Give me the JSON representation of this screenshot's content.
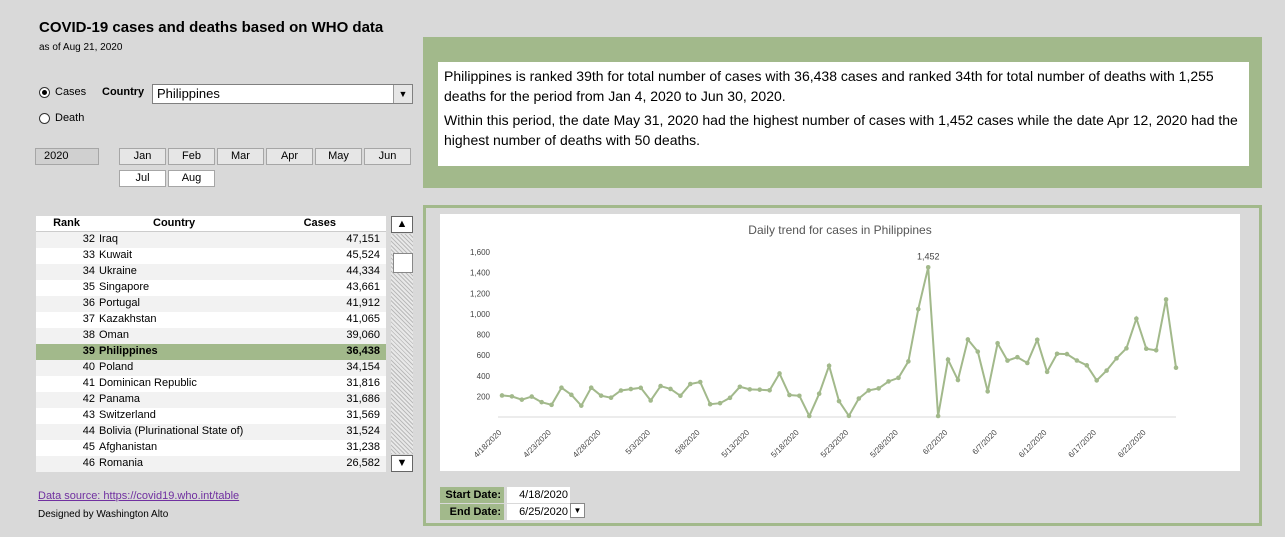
{
  "header": {
    "title": "COVID-19 cases and deaths based on WHO data",
    "asof": "as of Aug 21, 2020"
  },
  "metric": {
    "options": [
      "Cases",
      "Death"
    ],
    "selected": "Cases"
  },
  "country": {
    "label": "Country",
    "value": "Philippines"
  },
  "year_slicer": {
    "items": [
      "2020"
    ]
  },
  "month_slicer": {
    "items": [
      "Jan",
      "Feb",
      "Mar",
      "Apr",
      "May",
      "Jun",
      "Jul",
      "Aug"
    ]
  },
  "table": {
    "headers": [
      "Rank",
      "Country",
      "Cases"
    ],
    "rows": [
      {
        "rank": "32",
        "country": "Iraq",
        "cases": "47,151"
      },
      {
        "rank": "33",
        "country": "Kuwait",
        "cases": "45,524"
      },
      {
        "rank": "34",
        "country": "Ukraine",
        "cases": "44,334"
      },
      {
        "rank": "35",
        "country": "Singapore",
        "cases": "43,661"
      },
      {
        "rank": "36",
        "country": "Portugal",
        "cases": "41,912"
      },
      {
        "rank": "37",
        "country": "Kazakhstan",
        "cases": "41,065"
      },
      {
        "rank": "38",
        "country": "Oman",
        "cases": "39,060"
      },
      {
        "rank": "39",
        "country": "Philippines",
        "cases": "36,438",
        "highlight": true
      },
      {
        "rank": "40",
        "country": "Poland",
        "cases": "34,154"
      },
      {
        "rank": "41",
        "country": "Dominican Republic",
        "cases": "31,816"
      },
      {
        "rank": "42",
        "country": "Panama",
        "cases": "31,686"
      },
      {
        "rank": "43",
        "country": "Switzerland",
        "cases": "31,569"
      },
      {
        "rank": "44",
        "country": "Bolivia (Plurinational State of)",
        "cases": "31,524"
      },
      {
        "rank": "45",
        "country": "Afghanistan",
        "cases": "31,238"
      },
      {
        "rank": "46",
        "country": "Romania",
        "cases": "26,582"
      }
    ]
  },
  "scroll": {
    "up": "▲",
    "down": "▼"
  },
  "footer": {
    "source": "Data source: https://covid19.who.int/table",
    "designer": "Designed by Washington Alto"
  },
  "summary": {
    "line1": "Philippines is ranked 39th for total number of cases with 36,438 cases  and ranked 34th for total number of deaths with 1,255 deaths for the period from Jan 4, 2020 to Jun 30, 2020.",
    "line2": "Within this period, the date May 31, 2020 had the highest number of cases with 1,452 cases while the date Apr 12, 2020 had the highest number of deaths with 50 deaths."
  },
  "dates": {
    "start_label": "Start Date:",
    "start_value": "4/18/2020",
    "end_label": "End Date:",
    "end_value": "6/25/2020"
  },
  "colors": {
    "accent": "#a2b98b",
    "line": "#a2b98b"
  },
  "chart_data": {
    "type": "line",
    "title": "Daily trend for cases in Philippines",
    "xlabel": "",
    "ylabel": "",
    "ylim": [
      0,
      1600
    ],
    "yticks": [
      "200",
      "400",
      "600",
      "800",
      "1,000",
      "1,200",
      "1,400",
      "1,600"
    ],
    "xtick_labels": [
      "4/18/2020",
      "4/23/2020",
      "4/28/2020",
      "5/3/2020",
      "5/8/2020",
      "5/13/2020",
      "5/18/2020",
      "5/23/2020",
      "5/28/2020",
      "6/2/2020",
      "6/7/2020",
      "6/12/2020",
      "6/17/2020",
      "6/22/2020"
    ],
    "annotation": "1,452",
    "series": [
      {
        "values": [
          209,
          200,
          168,
          198,
          144,
          118,
          284,
          215,
          110,
          284,
          207,
          187,
          257,
          271,
          283,
          160,
          300,
          272,
          206,
          320,
          339,
          124,
          134,
          186,
          293,
          268,
          265,
          259,
          422,
          213,
          206,
          10,
          226,
          497,
          154,
          11,
          179,
          258,
          277,
          345,
          380,
          539,
          1046,
          1452,
          10,
          557,
          359,
          752,
          634,
          248,
          715,
          547,
          580,
          524,
          749,
          438,
          613,
          610,
          548,
          501,
          355,
          450,
          569,
          666,
          954,
          662,
          647,
          1140,
          478
        ]
      }
    ]
  }
}
